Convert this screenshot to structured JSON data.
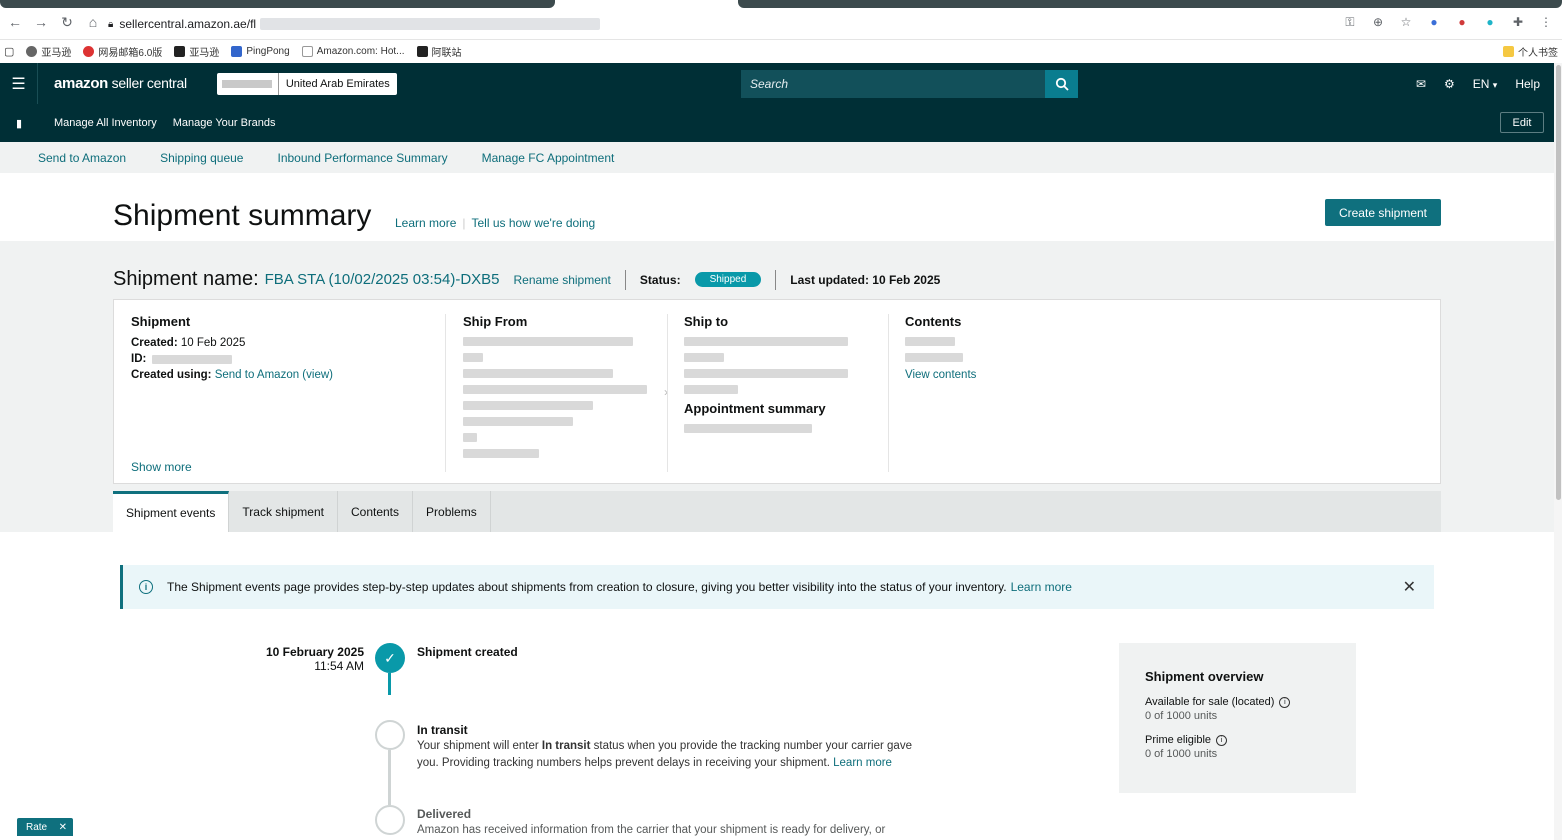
{
  "browser": {
    "url_visible": "sellercentral.amazon.ae/fl",
    "bookmarks": [
      "亚马逊",
      "网易邮箱6.0版",
      "亚马逊",
      "PingPong",
      "Amazon.com: Hot...",
      "阿联站"
    ],
    "bookmark_right": "个人书签"
  },
  "header": {
    "logo_main": "amazon",
    "logo_sub": " seller central",
    "marketplace_country": "United Arab Emirates",
    "search_placeholder": "Search",
    "language": "EN",
    "help": "Help"
  },
  "subnav": {
    "items": [
      "Manage All Inventory",
      "Manage Your Brands"
    ],
    "edit": "Edit"
  },
  "tabsnav": {
    "items": [
      "Send to Amazon",
      "Shipping queue",
      "Inbound Performance Summary",
      "Manage FC Appointment"
    ]
  },
  "title": {
    "page_title": "Shipment summary",
    "learn_more": "Learn more",
    "feedback": "Tell us how we're doing",
    "create_button": "Create shipment"
  },
  "shipment": {
    "name_label": "Shipment name:",
    "name_value": "FBA STA (10/02/2025 03:54)-DXB5",
    "rename": "Rename shipment",
    "status_label": "Status:",
    "status_value": "Shipped",
    "last_updated": "Last updated: 10 Feb 2025"
  },
  "details": {
    "shipment_heading": "Shipment",
    "created_label": "Created:",
    "created_value": "10 Feb 2025",
    "id_label": "ID:",
    "created_using_label": "Created using:",
    "created_using_value": "Send to Amazon (view)",
    "show_more": "Show more",
    "ship_from_heading": "Ship From",
    "ship_to_heading": "Ship to",
    "appointment_heading": "Appointment summary",
    "contents_heading": "Contents",
    "view_contents": "View contents"
  },
  "page_tabs": [
    "Shipment events",
    "Track shipment",
    "Contents",
    "Problems"
  ],
  "banner": {
    "text": "The Shipment events page provides step-by-step updates about shipments from creation to closure, giving you better visibility into the status of your inventory.",
    "link": "Learn more"
  },
  "timeline": {
    "created_date": "10 February 2025",
    "created_time": "11:54 AM",
    "created_title": "Shipment created",
    "transit_title": "In transit",
    "transit_desc_1": "Your shipment will enter ",
    "transit_desc_bold": "In transit",
    "transit_desc_2": " status when you provide the tracking number your carrier gave you. Providing tracking numbers helps prevent delays in receiving your shipment. ",
    "transit_link": "Learn more",
    "delivered_title": "Delivered",
    "delivered_desc": "Amazon has received information from the carrier that your shipment is ready for delivery, or"
  },
  "overview": {
    "heading": "Shipment overview",
    "available_label": "Available for sale (located)",
    "available_value": "0 of 1000 units",
    "prime_label": "Prime eligible",
    "prime_value": "0 of 1000 units"
  },
  "rate_widget": "Rate",
  "colors": {
    "header_bg": "#002f36",
    "accent": "#0f707e",
    "status_badge": "#0999a9",
    "link": "#0e6e7b"
  }
}
